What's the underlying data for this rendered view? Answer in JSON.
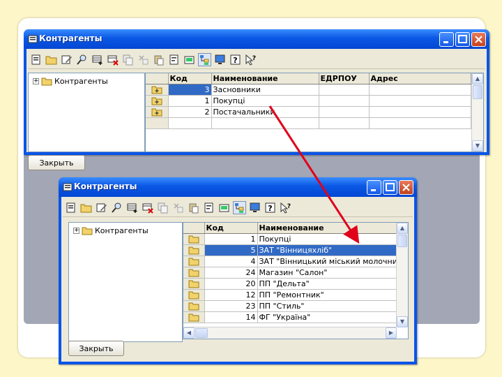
{
  "window_top": {
    "title": "Контрагенты",
    "tree_root": "Контрагенты",
    "columns": [
      "Код",
      "Наименование",
      "ЕДРПОУ",
      "Адрес"
    ],
    "rows": [
      {
        "code": "3",
        "name": "Засновники",
        "edrpou": "",
        "address": ""
      },
      {
        "code": "1",
        "name": "Покупці",
        "edrpou": "",
        "address": ""
      },
      {
        "code": "2",
        "name": "Постачальники",
        "edrpou": "",
        "address": ""
      }
    ],
    "close_label": "Закрыть"
  },
  "window_bottom": {
    "title": "Контрагенты",
    "tree_root": "Контрагенты",
    "columns": [
      "Код",
      "Наименование"
    ],
    "rows": [
      {
        "code": "1",
        "name": "Покупці"
      },
      {
        "code": "5",
        "name": "ЗАТ \"Вінницяхліб\""
      },
      {
        "code": "4",
        "name": "ЗАТ \"Вінницький міський молочни"
      },
      {
        "code": "24",
        "name": "Магазин \"Салон\""
      },
      {
        "code": "20",
        "name": "ПП \"Дельта\""
      },
      {
        "code": "12",
        "name": "ПП \"Ремонтник\""
      },
      {
        "code": "23",
        "name": "ПП \"Стиль\""
      },
      {
        "code": "14",
        "name": "ФГ \"Україна\""
      }
    ],
    "close_label": "Закрыть"
  },
  "toolbar_icons": [
    "new-icon",
    "folder-icon",
    "edit-icon",
    "find-icon",
    "add-row-icon",
    "delete-row-icon",
    "copy-icon",
    "move-icon",
    "paste-icon",
    "print-icon",
    "properties-icon",
    "tree-view-icon",
    "monitor-icon",
    "help-icon",
    "context-help-icon"
  ],
  "colors": {
    "titlebar": "#0a54e8",
    "selection": "#316ac5",
    "arrow": "#e0001a",
    "background": "#fdf6c8"
  }
}
